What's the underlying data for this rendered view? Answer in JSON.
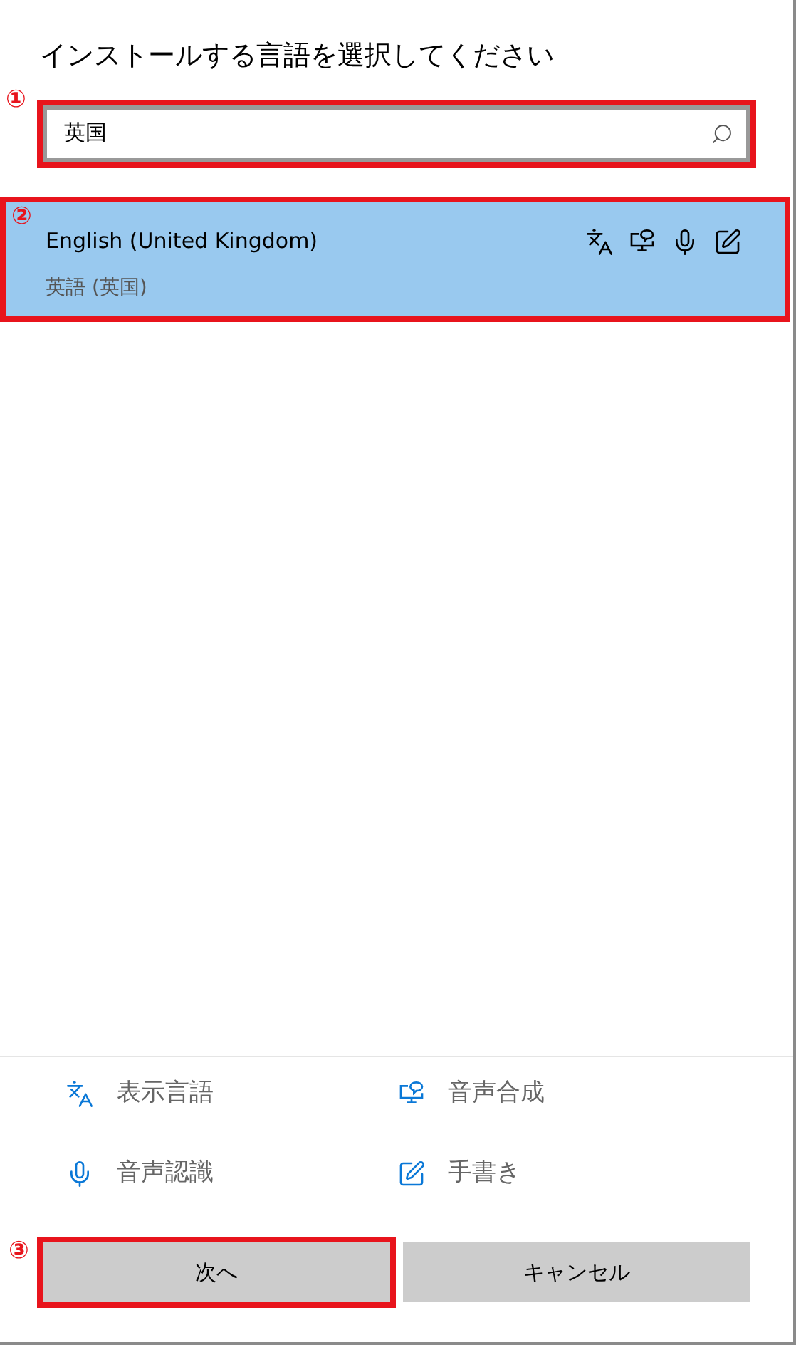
{
  "title": "インストールする言語を選択してください",
  "search": {
    "value": "英国",
    "marker": "①",
    "highlighted": true
  },
  "languages": [
    {
      "name": "English (United Kingdom)",
      "native": "英語 (英国)",
      "selected": true,
      "marker": "②",
      "highlighted": true,
      "features": [
        {
          "kind": "display"
        },
        {
          "kind": "tts"
        },
        {
          "kind": "speech"
        },
        {
          "kind": "handwriting"
        }
      ]
    }
  ],
  "legend": [
    {
      "kind": "display",
      "label": "表示言語"
    },
    {
      "kind": "tts",
      "label": "音声合成"
    },
    {
      "kind": "speech",
      "label": "音声認識"
    },
    {
      "kind": "handwriting",
      "label": "手書き"
    }
  ],
  "buttons": [
    {
      "label": "次へ",
      "marker": "③",
      "highlighted": true
    },
    {
      "label": "キャンセル",
      "highlighted": false
    }
  ]
}
